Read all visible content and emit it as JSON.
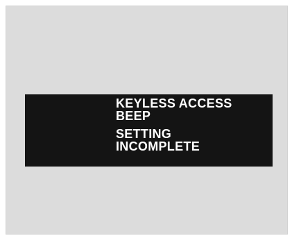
{
  "display": {
    "title": {
      "line1": "KEYLESS ACCESS",
      "line2": "BEEP"
    },
    "status": {
      "line1": "SETTING",
      "line2": "INCOMPLETE"
    }
  },
  "colors": {
    "background_frame": "#dcdcdc",
    "display_background": "#141414",
    "display_text": "#ffffff"
  }
}
